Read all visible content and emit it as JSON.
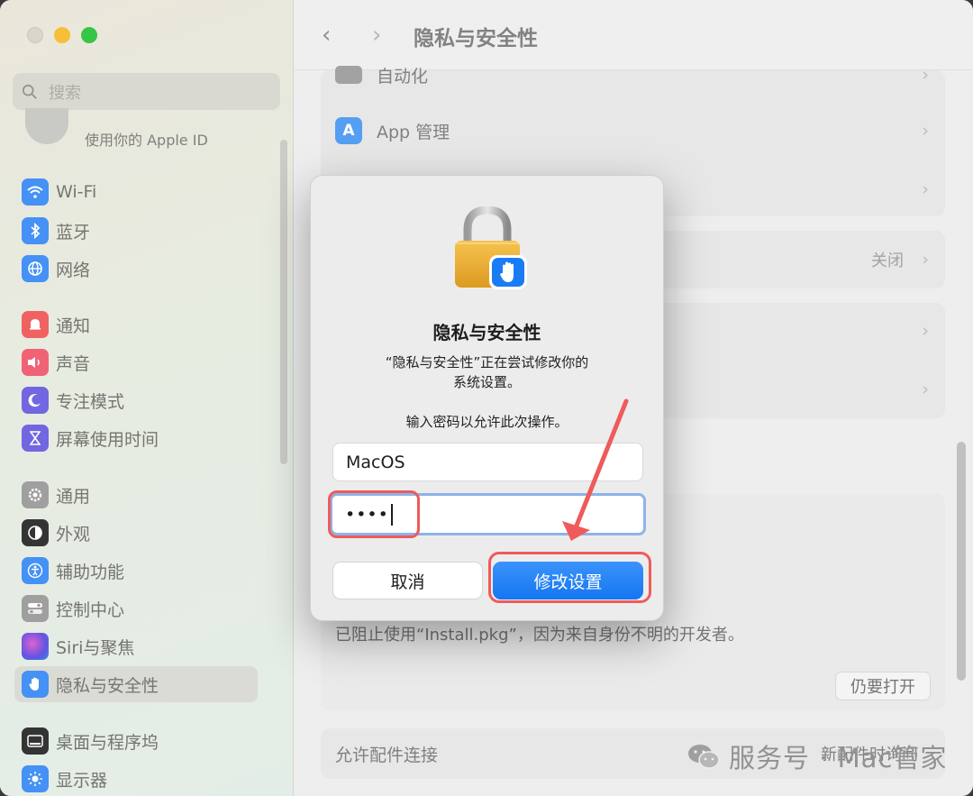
{
  "window": {
    "title": "隐私与安全性"
  },
  "sidebar": {
    "search_placeholder": "搜索",
    "apple_id_label": "使用你的 Apple ID",
    "items": [
      {
        "label": "Wi-Fi",
        "icon": "wifi-icon",
        "color": "#3b8cf5"
      },
      {
        "label": "蓝牙",
        "icon": "bluetooth-icon",
        "color": "#3b8cf5"
      },
      {
        "label": "网络",
        "icon": "globe-icon",
        "color": "#3b8cf5"
      },
      {
        "label": "通知",
        "icon": "bell-icon",
        "color": "#f05a5a"
      },
      {
        "label": "声音",
        "icon": "speaker-icon",
        "color": "#f05a6e"
      },
      {
        "label": "专注模式",
        "icon": "moon-icon",
        "color": "#6b5ee0"
      },
      {
        "label": "屏幕使用时间",
        "icon": "hourglass-icon",
        "color": "#6b5ee0"
      },
      {
        "label": "通用",
        "icon": "gear-icon",
        "color": "#9a9a9a"
      },
      {
        "label": "外观",
        "icon": "appearance-icon",
        "color": "#2a2a2a"
      },
      {
        "label": "辅助功能",
        "icon": "accessibility-icon",
        "color": "#3b8cf5"
      },
      {
        "label": "控制中心",
        "icon": "toggles-icon",
        "color": "#9a9a9a"
      },
      {
        "label": "Siri与聚焦",
        "icon": "siri-icon",
        "color": "#7a5ae0"
      },
      {
        "label": "隐私与安全性",
        "icon": "hand-icon",
        "color": "#3b8cf5"
      },
      {
        "label": "桌面与程序坞",
        "icon": "dock-icon",
        "color": "#2a2a2a"
      },
      {
        "label": "显示器",
        "icon": "sun-icon",
        "color": "#3b8cf5"
      }
    ],
    "active_index": 12
  },
  "toolbar": {
    "back_icon": "chevron-left-icon",
    "forward_icon": "chevron-right-icon",
    "title": "隐私与安全性"
  },
  "main": {
    "automation_label": "自动化",
    "app_management_label": "App 管理",
    "closed_value": "关闭",
    "blocked_message": "已阻止使用“Install.pkg”，因为来自身份不明的开发者。",
    "open_anyway_label": "仍要打开",
    "accessory_label": "允许配件连接",
    "accessory_value": "新配件时询问"
  },
  "dialog": {
    "title": "隐私与安全性",
    "message_line1": "“隐私与安全性”正在尝试修改你的",
    "message_line2": "系统设置。",
    "prompt": "输入密码以允许此次操作。",
    "username_value": "MacOS",
    "password_value": "••••",
    "cancel_label": "取消",
    "confirm_label": "修改设置",
    "accent_color": "#1a7cf5"
  },
  "watermark": {
    "text": "服务号 · Mac管家"
  },
  "annotation": {
    "highlight_color": "#ef5a5a"
  }
}
